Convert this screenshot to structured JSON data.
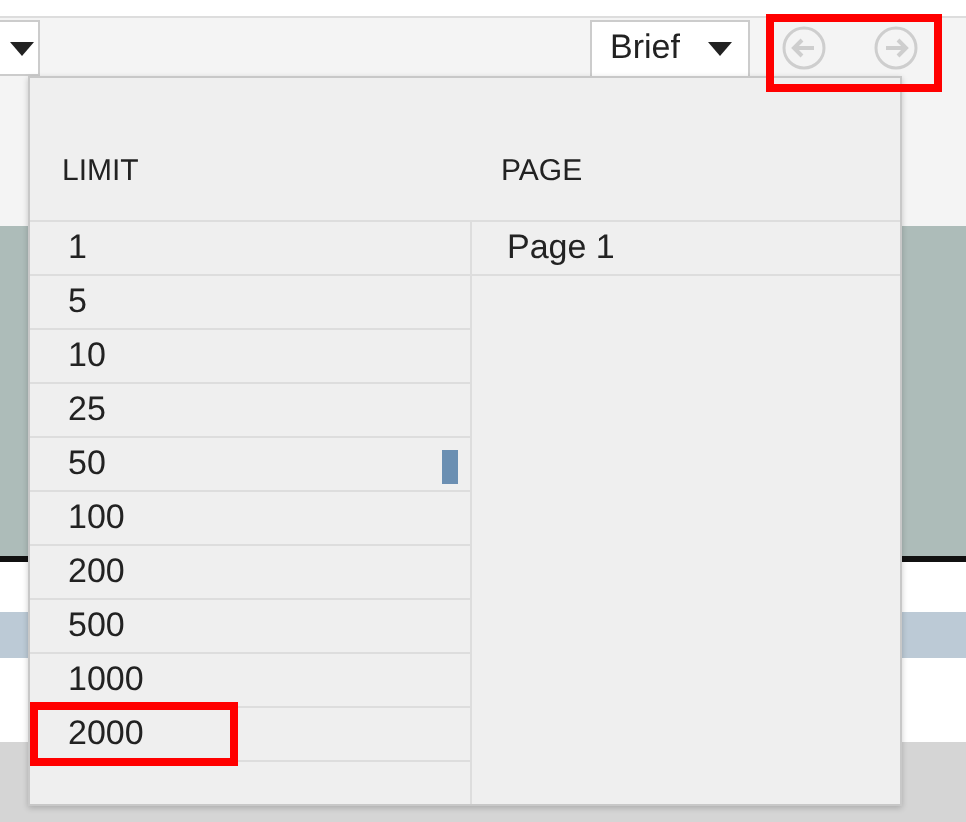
{
  "toolbar": {
    "view_select": {
      "value": "Brief"
    },
    "nav": [
      {
        "kind": "prev",
        "disabled": true
      },
      {
        "kind": "next",
        "disabled": true
      }
    ]
  },
  "popup": {
    "columns": [
      "LIMIT",
      "PAGE"
    ],
    "limits": [
      {
        "label": "1",
        "highlighted": false
      },
      {
        "label": "5",
        "highlighted": false
      },
      {
        "label": "10",
        "highlighted": false
      },
      {
        "label": "25",
        "highlighted": false
      },
      {
        "label": "50",
        "highlighted": false
      },
      {
        "label": "100",
        "highlighted": false
      },
      {
        "label": "200",
        "highlighted": false
      },
      {
        "label": "500",
        "highlighted": false
      },
      {
        "label": "1000",
        "highlighted": false
      },
      {
        "label": "2000",
        "highlighted": true
      }
    ],
    "pages": [
      "Page 1"
    ]
  }
}
